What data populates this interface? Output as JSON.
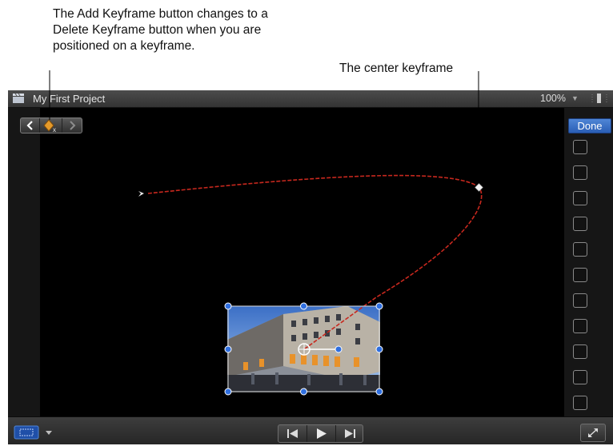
{
  "callouts": {
    "add_keyframe": "The Add Keyframe button changes to a Delete Keyframe button when you are positioned on a keyframe.",
    "center_keyframe": "The center keyframe"
  },
  "viewer": {
    "project_title": "My First Project",
    "zoom_level": "100%",
    "done_label": "Done",
    "checkbox_count": 11
  },
  "icons": {
    "app": "clapper-icon",
    "prev_keyframe": "chevron-left-icon",
    "delete_keyframe": "delete-keyframe-icon",
    "next_keyframe": "chevron-right-icon",
    "zoom_menu": "chevron-down-icon",
    "view_options": "view-toggle-icon",
    "transform": "transform-tool-icon",
    "go_to_start": "skip-back-icon",
    "play": "play-icon",
    "go_to_end": "skip-forward-icon",
    "fullscreen": "fullscreen-icon"
  },
  "colors": {
    "motion_path": "#c8281e",
    "handle": "#2f6fe0",
    "done_button": "#3a6fc8"
  }
}
